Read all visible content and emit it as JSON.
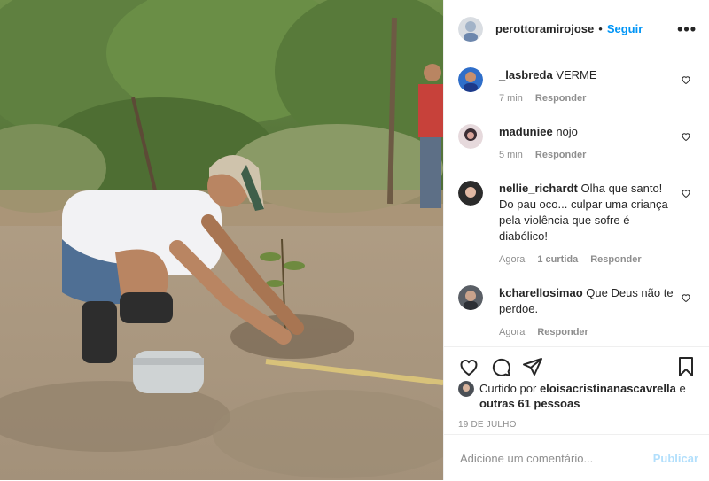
{
  "post": {
    "username": "perottoramirojose",
    "separator": "•",
    "follow_label": "Seguir",
    "more_label": "•••"
  },
  "comments": [
    {
      "user": "_lasbreda",
      "text": "VERME",
      "time": "7 min",
      "likes": "",
      "reply": "Responder"
    },
    {
      "user": "maduniee",
      "text": "nojo",
      "time": "5 min",
      "likes": "",
      "reply": "Responder"
    },
    {
      "user": "nellie_richardt",
      "text": "Olha que santo! Do pau oco... culpar uma criança pela violência que sofre é diabólico!",
      "time": "Agora",
      "likes": "1 curtida",
      "reply": "Responder"
    },
    {
      "user": "kcharellosimao",
      "text": "Que Deus não te perdoe.",
      "time": "Agora",
      "likes": "",
      "reply": "Responder"
    }
  ],
  "likes": {
    "prefix": "Curtido por",
    "user": "eloisacristinanascavrella",
    "middle": "e",
    "others": "outras 61 pessoas"
  },
  "date": "19 DE JULHO",
  "add_comment": {
    "placeholder": "Adicione um comentário...",
    "publish_label": "Publicar"
  },
  "colors": {
    "link_blue": "#0095f6",
    "publish_disabled": "#b2dffc",
    "meta_gray": "#8e8e8e"
  },
  "icons": [
    "heart-icon",
    "comment-icon",
    "share-icon",
    "bookmark-icon",
    "more-icon"
  ]
}
